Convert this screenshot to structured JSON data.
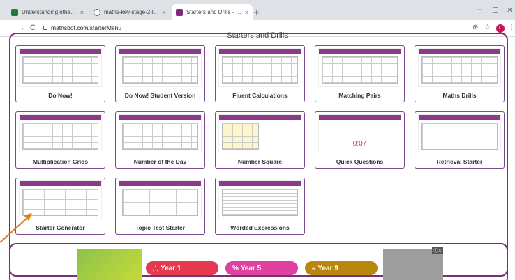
{
  "browser": {
    "tabs": [
      {
        "title": "Understanding other powers of t",
        "color": "#188038"
      },
      {
        "title": "maths-key-stage-2-lesson-MAT",
        "color": "#5f6368"
      },
      {
        "title": "Starters and Drills - Mathsbot.co",
        "color": "#7b2d7b"
      }
    ],
    "tab_close": "×",
    "new_tab": "+",
    "window_controls": {
      "minimize": "–",
      "maximize": "☐",
      "close": "✕"
    },
    "nav": {
      "back": "←",
      "forward": "→",
      "reload": "C"
    },
    "url": "mathsbot.com/starterMenu",
    "toolbar_icons": {
      "zoom": "⊕",
      "star": "☆",
      "menu": "⋮"
    },
    "avatar_letter": "L"
  },
  "page": {
    "heading": "Starters and Drills",
    "accent_color": "#7b2d7b",
    "cards": [
      {
        "label": "Do Now!"
      },
      {
        "label": "Do Now! Student Version"
      },
      {
        "label": "Fluent Calculations"
      },
      {
        "label": "Matching Pairs"
      },
      {
        "label": "Maths Drills"
      },
      {
        "label": "Multiplication Grids"
      },
      {
        "label": "Number of the Day"
      },
      {
        "label": "Number Square"
      },
      {
        "label": "Quick Questions",
        "thumb_text": "0:07"
      },
      {
        "label": "Retrieval Starter"
      },
      {
        "label": "Starter Generator"
      },
      {
        "label": "Topic Test Starter"
      },
      {
        "label": "Worded Expressions"
      }
    ]
  },
  "ad": {
    "buttons": [
      {
        "label": "Year 1",
        "icon": "sparkle-icon",
        "glyph": "⸫",
        "color": "#e53950"
      },
      {
        "label": "Year 5",
        "icon": "percent-icon",
        "glyph": "%",
        "color": "#e040a0"
      },
      {
        "label": "Year 9",
        "icon": "approx-icon",
        "glyph": "≈",
        "color": "#b8860b"
      }
    ],
    "close_label": "ⓘX"
  }
}
